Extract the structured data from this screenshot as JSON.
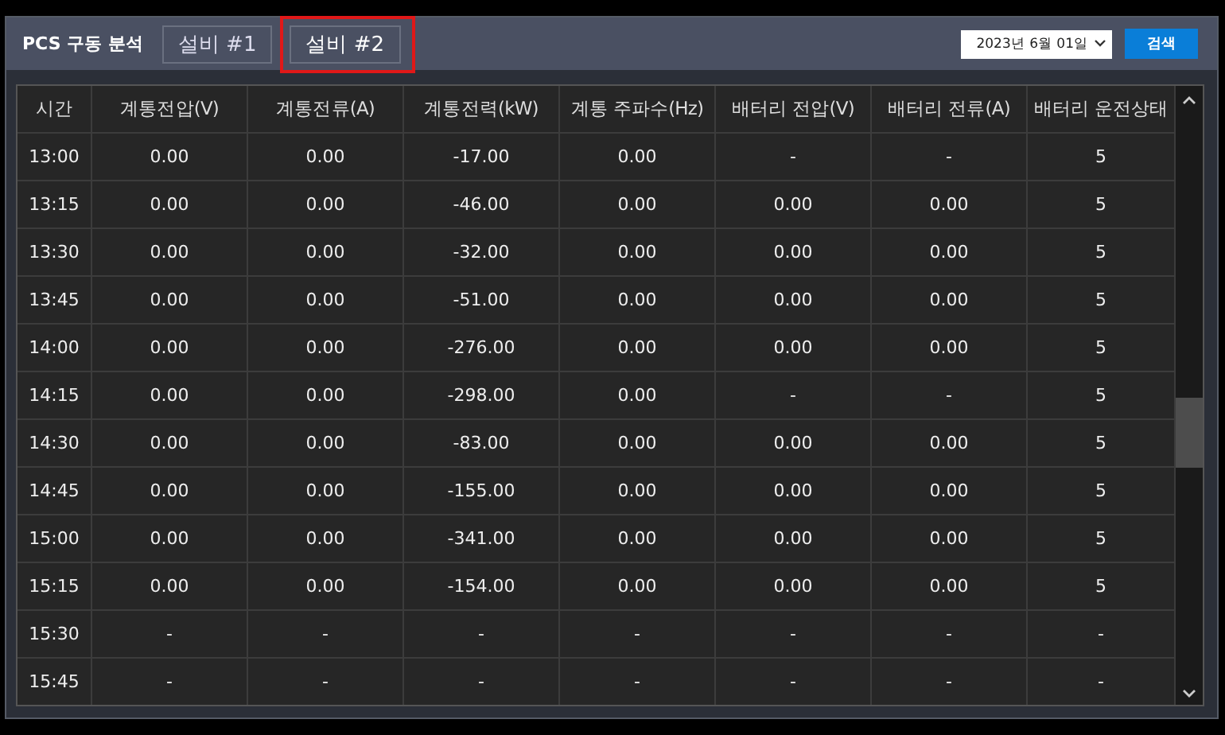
{
  "header": {
    "title": "PCS 구동 분석",
    "tabs": [
      {
        "label": "설비 #1",
        "selected": false
      },
      {
        "label": "설비 #2",
        "selected": true
      }
    ],
    "date": {
      "value": "2023년 6월 01일"
    },
    "search_button": "검색"
  },
  "table": {
    "columns": [
      "시간",
      "계통전압(V)",
      "계통전류(A)",
      "계통전력(kW)",
      "계통 주파수(Hz)",
      "배터리 전압(V)",
      "배터리 전류(A)",
      "배터리 운전상태"
    ],
    "rows": [
      [
        "13:00",
        "0.00",
        "0.00",
        "-17.00",
        "0.00",
        "-",
        "-",
        "5"
      ],
      [
        "13:15",
        "0.00",
        "0.00",
        "-46.00",
        "0.00",
        "0.00",
        "0.00",
        "5"
      ],
      [
        "13:30",
        "0.00",
        "0.00",
        "-32.00",
        "0.00",
        "0.00",
        "0.00",
        "5"
      ],
      [
        "13:45",
        "0.00",
        "0.00",
        "-51.00",
        "0.00",
        "0.00",
        "0.00",
        "5"
      ],
      [
        "14:00",
        "0.00",
        "0.00",
        "-276.00",
        "0.00",
        "0.00",
        "0.00",
        "5"
      ],
      [
        "14:15",
        "0.00",
        "0.00",
        "-298.00",
        "0.00",
        "-",
        "-",
        "5"
      ],
      [
        "14:30",
        "0.00",
        "0.00",
        "-83.00",
        "0.00",
        "0.00",
        "0.00",
        "5"
      ],
      [
        "14:45",
        "0.00",
        "0.00",
        "-155.00",
        "0.00",
        "0.00",
        "0.00",
        "5"
      ],
      [
        "15:00",
        "0.00",
        "0.00",
        "-341.00",
        "0.00",
        "0.00",
        "0.00",
        "5"
      ],
      [
        "15:15",
        "0.00",
        "0.00",
        "-154.00",
        "0.00",
        "0.00",
        "0.00",
        "5"
      ],
      [
        "15:30",
        "-",
        "-",
        "-",
        "-",
        "-",
        "-",
        "-"
      ],
      [
        "15:45",
        "-",
        "-",
        "-",
        "-",
        "-",
        "-",
        "-"
      ]
    ]
  }
}
